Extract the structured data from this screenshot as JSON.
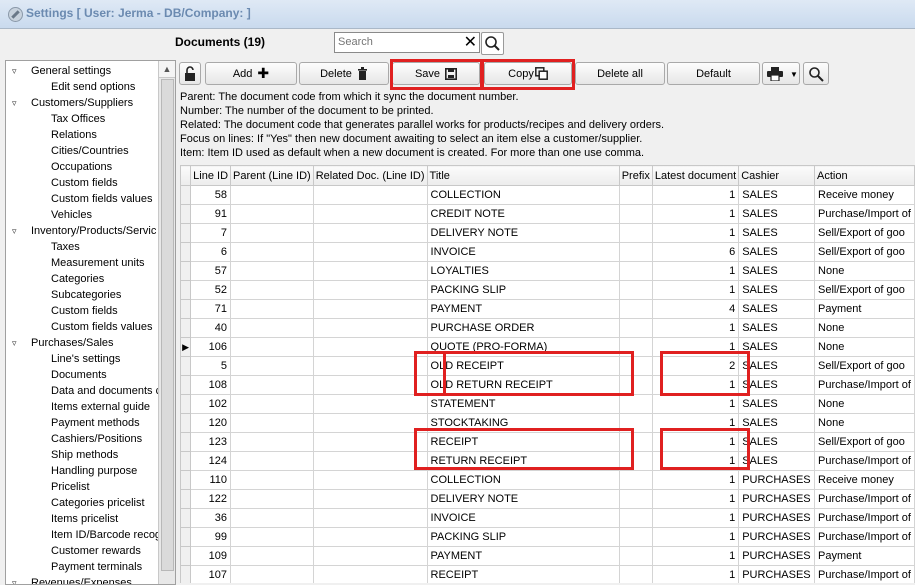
{
  "window": {
    "title": "Settings  [ User: Jerma - DB/Company:  ]"
  },
  "documents": {
    "title": "Documents (19)"
  },
  "search": {
    "placeholder": "Search",
    "clear_icon": "close-icon",
    "search_icon": "magnifier-icon"
  },
  "toolbar": {
    "lock_icon": "unlock-icon",
    "add_label": "Add",
    "add_icon": "plus-icon",
    "delete_label": "Delete",
    "delete_icon": "trash-icon",
    "save_label": "Save",
    "save_icon": "floppy-disk-icon",
    "copy_label": "Copy",
    "copy_icon": "copy-icon",
    "delete_all_label": "Delete all",
    "default_label": "Default",
    "print_icon": "printer-icon",
    "dropdown_icon": "caret-down-icon",
    "zoom_icon": "magnifier-icon"
  },
  "info_lines": [
    "Parent: The document code from which it sync the document number.",
    "Number: The number of the document to be printed.",
    "Related: The document code that generates parallel works for products/recipes and delivery orders.",
    "Focus on lines: If \"Yes\" then new document awaiting to select an item else a customer/supplier.",
    "Item: Item ID used as default when a new document is created. For more than one use comma."
  ],
  "tree": [
    {
      "label": "General settings",
      "level": 0,
      "expanded": true
    },
    {
      "label": "Edit send options",
      "level": 1
    },
    {
      "label": "Customers/Suppliers",
      "level": 0,
      "expanded": true
    },
    {
      "label": "Tax Offices",
      "level": 1
    },
    {
      "label": "Relations",
      "level": 1
    },
    {
      "label": "Cities/Countries",
      "level": 1
    },
    {
      "label": "Occupations",
      "level": 1
    },
    {
      "label": "Custom fields",
      "level": 1
    },
    {
      "label": "Custom fields values",
      "level": 1
    },
    {
      "label": "Vehicles",
      "level": 1
    },
    {
      "label": "Inventory/Products/Servic",
      "level": 0,
      "expanded": true
    },
    {
      "label": "Taxes",
      "level": 1
    },
    {
      "label": "Measurement units",
      "level": 1
    },
    {
      "label": "Categories",
      "level": 1
    },
    {
      "label": "Subcategories",
      "level": 1
    },
    {
      "label": "Custom fields",
      "level": 1
    },
    {
      "label": "Custom fields values",
      "level": 1
    },
    {
      "label": "Purchases/Sales",
      "level": 0,
      "expanded": true
    },
    {
      "label": "Line's settings",
      "level": 1
    },
    {
      "label": "Documents",
      "level": 1
    },
    {
      "label": "Data and documents c",
      "level": 1
    },
    {
      "label": "Items external guide",
      "level": 1
    },
    {
      "label": "Payment methods",
      "level": 1
    },
    {
      "label": "Cashiers/Positions",
      "level": 1
    },
    {
      "label": "Ship methods",
      "level": 1
    },
    {
      "label": "Handling purpose",
      "level": 1
    },
    {
      "label": "Pricelist",
      "level": 1
    },
    {
      "label": "Categories pricelist",
      "level": 1
    },
    {
      "label": "Items pricelist",
      "level": 1
    },
    {
      "label": "Item ID/Barcode recog",
      "level": 1
    },
    {
      "label": "Customer rewards",
      "level": 1
    },
    {
      "label": "Payment terminals",
      "level": 1
    },
    {
      "label": "Revenues/Expenses",
      "level": 0,
      "expanded": true
    }
  ],
  "grid": {
    "columns": [
      "Line ID",
      "Parent (Line ID)",
      "Related Doc. (Line ID)",
      "Title",
      "Prefix",
      "Latest document",
      "Cashier",
      "Action"
    ],
    "current_row_icon": "row-pointer-icon",
    "current_row_index": 8,
    "rows": [
      {
        "line_id": "58",
        "parent": "",
        "related": "",
        "title": "COLLECTION",
        "prefix": "",
        "latest": "1",
        "cashier": "SALES",
        "action": "Receive money"
      },
      {
        "line_id": "91",
        "parent": "",
        "related": "",
        "title": "CREDIT NOTE",
        "prefix": "",
        "latest": "1",
        "cashier": "SALES",
        "action": "Purchase/Import of"
      },
      {
        "line_id": "7",
        "parent": "",
        "related": "",
        "title": "DELIVERY NOTE",
        "prefix": "",
        "latest": "1",
        "cashier": "SALES",
        "action": "Sell/Export of goo"
      },
      {
        "line_id": "6",
        "parent": "",
        "related": "",
        "title": "INVOICE",
        "prefix": "",
        "latest": "6",
        "cashier": "SALES",
        "action": "Sell/Export of goo"
      },
      {
        "line_id": "57",
        "parent": "",
        "related": "",
        "title": "LOYALTIES",
        "prefix": "",
        "latest": "1",
        "cashier": "SALES",
        "action": "None"
      },
      {
        "line_id": "52",
        "parent": "",
        "related": "",
        "title": "PACKING SLIP",
        "prefix": "",
        "latest": "1",
        "cashier": "SALES",
        "action": "Sell/Export of goo"
      },
      {
        "line_id": "71",
        "parent": "",
        "related": "",
        "title": "PAYMENT",
        "prefix": "",
        "latest": "4",
        "cashier": "SALES",
        "action": "Payment"
      },
      {
        "line_id": "40",
        "parent": "",
        "related": "",
        "title": "PURCHASE ORDER",
        "prefix": "",
        "latest": "1",
        "cashier": "SALES",
        "action": "None"
      },
      {
        "line_id": "106",
        "parent": "",
        "related": "",
        "title": "QUOTE (PRO-FORMA)",
        "prefix": "",
        "latest": "1",
        "cashier": "SALES",
        "action": "None"
      },
      {
        "line_id": "5",
        "parent": "",
        "related": "",
        "title": "OLD RECEIPT",
        "prefix": "",
        "latest": "2",
        "cashier": "SALES",
        "action": "Sell/Export of goo"
      },
      {
        "line_id": "108",
        "parent": "",
        "related": "",
        "title": "OLD RETURN RECEIPT",
        "prefix": "",
        "latest": "1",
        "cashier": "SALES",
        "action": "Purchase/Import of"
      },
      {
        "line_id": "102",
        "parent": "",
        "related": "",
        "title": "STATEMENT",
        "prefix": "",
        "latest": "1",
        "cashier": "SALES",
        "action": "None"
      },
      {
        "line_id": "120",
        "parent": "",
        "related": "",
        "title": "STOCKTAKING",
        "prefix": "",
        "latest": "1",
        "cashier": "SALES",
        "action": "None"
      },
      {
        "line_id": "123",
        "parent": "",
        "related": "",
        "title": "RECEIPT",
        "prefix": "",
        "latest": "1",
        "cashier": "SALES",
        "action": "Sell/Export of goo"
      },
      {
        "line_id": "124",
        "parent": "",
        "related": "",
        "title": "RETURN RECEIPT",
        "prefix": "",
        "latest": "1",
        "cashier": "SALES",
        "action": "Purchase/Import of"
      },
      {
        "line_id": "110",
        "parent": "",
        "related": "",
        "title": "COLLECTION",
        "prefix": "",
        "latest": "1",
        "cashier": "PURCHASES",
        "action": "Receive money"
      },
      {
        "line_id": "122",
        "parent": "",
        "related": "",
        "title": "DELIVERY NOTE",
        "prefix": "",
        "latest": "1",
        "cashier": "PURCHASES",
        "action": "Purchase/Import of"
      },
      {
        "line_id": "36",
        "parent": "",
        "related": "",
        "title": "INVOICE",
        "prefix": "",
        "latest": "1",
        "cashier": "PURCHASES",
        "action": "Purchase/Import of"
      },
      {
        "line_id": "99",
        "parent": "",
        "related": "",
        "title": "PACKING SLIP",
        "prefix": "",
        "latest": "1",
        "cashier": "PURCHASES",
        "action": "Purchase/Import of"
      },
      {
        "line_id": "109",
        "parent": "",
        "related": "",
        "title": "PAYMENT",
        "prefix": "",
        "latest": "1",
        "cashier": "PURCHASES",
        "action": "Payment"
      },
      {
        "line_id": "107",
        "parent": "",
        "related": "",
        "title": "RECEIPT",
        "prefix": "",
        "latest": "1",
        "cashier": "PURCHASES",
        "action": "Purchase/Import of"
      }
    ]
  },
  "annotation_color": "#e02020"
}
